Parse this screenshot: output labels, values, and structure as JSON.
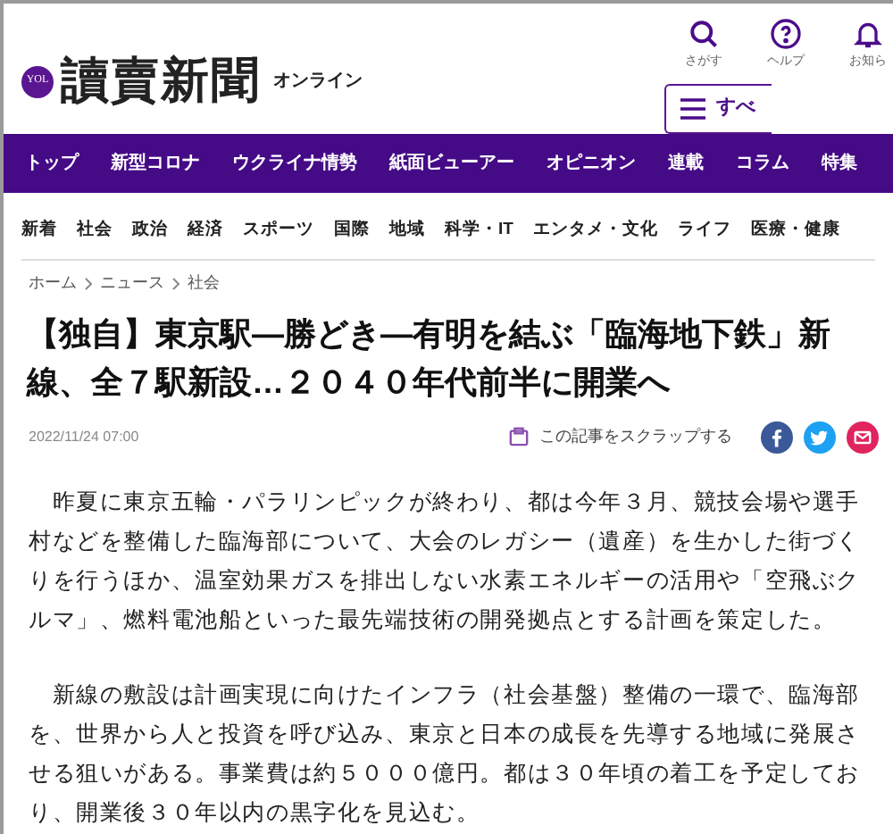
{
  "header": {
    "logo_badge": "YOL",
    "logo_text": "讀賣新聞",
    "logo_suffix": "オンライン",
    "tools": [
      {
        "kind": "search",
        "label": "さがす"
      },
      {
        "kind": "help",
        "label": "ヘルプ"
      },
      {
        "kind": "bell",
        "label": "お知ら"
      }
    ],
    "menu_button": "すべ"
  },
  "main_nav": [
    {
      "label": "トップ"
    },
    {
      "label": "新型コロナ"
    },
    {
      "label": "ウクライナ情勢"
    },
    {
      "label": "紙面ビューアー"
    },
    {
      "label": "オピニオン"
    },
    {
      "label": "連載"
    },
    {
      "label": "コラム"
    },
    {
      "label": "特集"
    }
  ],
  "sub_nav": [
    {
      "label": "新着"
    },
    {
      "label": "社会"
    },
    {
      "label": "政治"
    },
    {
      "label": "経済"
    },
    {
      "label": "スポーツ"
    },
    {
      "label": "国際"
    },
    {
      "label": "地域"
    },
    {
      "label": "科学・IT"
    },
    {
      "label": "エンタメ・文化"
    },
    {
      "label": "ライフ"
    },
    {
      "label": "医療・健康"
    }
  ],
  "breadcrumb": [
    {
      "label": "ホーム"
    },
    {
      "label": "ニュース"
    },
    {
      "label": "社会"
    }
  ],
  "article": {
    "title": "【独自】東京駅―勝どき―有明を結ぶ「臨海地下鉄」新線、全７駅新設…２０４０年代前半に開業へ",
    "date": "2022/11/24 07:00",
    "scrap_label": "この記事をスクラップする",
    "share": [
      {
        "kind": "facebook",
        "color": "#3b5998"
      },
      {
        "kind": "twitter",
        "color": "#1da1f2"
      },
      {
        "kind": "mail",
        "color": "#e0245e"
      }
    ],
    "paragraphs": [
      "　昨夏に東京五輪・パラリンピックが終わり、都は今年３月、競技会場や選手村などを整備した臨海部について、大会のレガシー（遺産）を生かした街づくりを行うほか、温室効果ガスを排出しない水素エネルギーの活用や「空飛ぶクルマ」、燃料電池船といった最先端技術の開発拠点とする計画を策定した。",
      "　新線の敷設は計画実現に向けたインフラ（社会基盤）整備の一環で、臨海部を、世界から人と投資を呼び込み、東京と日本の成長を先導する地域に発展させる狙いがある。事業費は約５０００億円。都は３０年頃の着工を予定しており、開業後３０年以内の黒字化を見込む。"
    ]
  }
}
